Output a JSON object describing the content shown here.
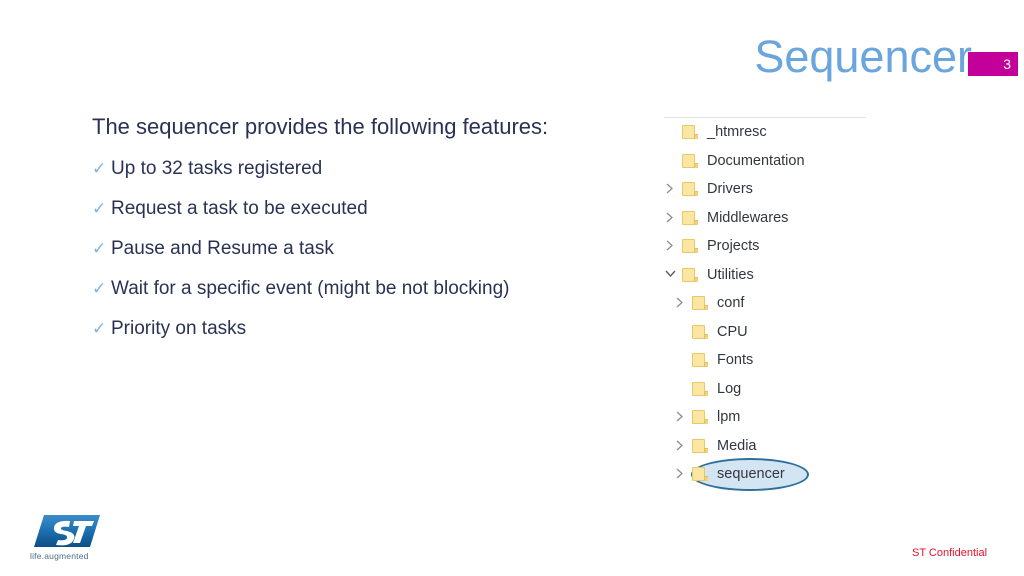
{
  "slide": {
    "title": "Sequencer",
    "page_number": "3",
    "badge_color": "#c3009a",
    "title_color": "#6ba5dd",
    "text_color": "#2a3254"
  },
  "content": {
    "lead": "The sequencer provides the following features:",
    "check_glyph": "✓",
    "bullets": [
      {
        "text": "Up to 32 tasks registered"
      },
      {
        "text": "Request a task to be executed"
      },
      {
        "text": "Pause and Resume a task"
      },
      {
        "text": "Wait for a specific event (might be not blocking)"
      },
      {
        "text": "Priority on tasks"
      }
    ]
  },
  "file_tree": {
    "items": [
      {
        "label": "_htmresc",
        "level": 1,
        "twisty": "none",
        "highlighted": false
      },
      {
        "label": "Documentation",
        "level": 1,
        "twisty": "none",
        "highlighted": false
      },
      {
        "label": "Drivers",
        "level": 1,
        "twisty": "collapsed",
        "highlighted": false
      },
      {
        "label": "Middlewares",
        "level": 1,
        "twisty": "collapsed",
        "highlighted": false
      },
      {
        "label": "Projects",
        "level": 1,
        "twisty": "collapsed",
        "highlighted": false
      },
      {
        "label": "Utilities",
        "level": 1,
        "twisty": "expanded",
        "highlighted": false
      },
      {
        "label": "conf",
        "level": 2,
        "twisty": "collapsed",
        "highlighted": false
      },
      {
        "label": "CPU",
        "level": 2,
        "twisty": "none",
        "highlighted": false
      },
      {
        "label": "Fonts",
        "level": 2,
        "twisty": "none",
        "highlighted": false
      },
      {
        "label": "Log",
        "level": 2,
        "twisty": "none",
        "highlighted": false
      },
      {
        "label": "lpm",
        "level": 2,
        "twisty": "collapsed",
        "highlighted": false
      },
      {
        "label": "Media",
        "level": 2,
        "twisty": "collapsed",
        "highlighted": false
      },
      {
        "label": "sequencer",
        "level": 2,
        "twisty": "collapsed",
        "highlighted": true
      }
    ],
    "highlight_color": "#2e6f9c"
  },
  "footer": {
    "logo_text": "ST",
    "tagline": "life.augmented",
    "confidential": "ST Confidential",
    "confidential_color": "#e8102a"
  }
}
